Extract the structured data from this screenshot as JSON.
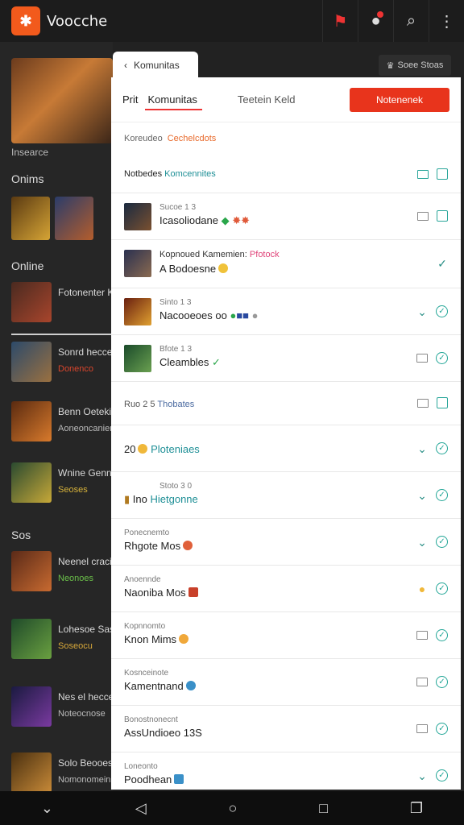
{
  "app": {
    "title": "Voocche"
  },
  "background": {
    "hero_label": "Insearce",
    "section1": "Onims",
    "section2": "Online",
    "section3": "Sos",
    "rows": [
      {
        "title": "Fotonenter Ker",
        "sub": ""
      },
      {
        "title": "Sonrd hecce",
        "sub": "Donenco"
      },
      {
        "title": "Benn Oetekit",
        "sub": "Aoneoncaniene"
      },
      {
        "title": "Wnine Genno",
        "sub": "Seoses"
      },
      {
        "title": "Neenel cracie",
        "sub": "Neonoes"
      },
      {
        "title": "Lohesoe Sas",
        "sub": "Soseocu"
      },
      {
        "title": "Nes el hecces",
        "sub": "Noteocnose"
      },
      {
        "title": "Solo Beooes",
        "sub": "Nomonomeins"
      }
    ],
    "right_badge": "Soee Stoas"
  },
  "panel": {
    "chip": "Komunitas",
    "tabs": {
      "first": "Prit",
      "active": "Komunitas",
      "other": "Teetein Keld"
    },
    "cta": "Notenenek",
    "breadcrumb": {
      "a": "Koreudeo",
      "b": "Cechelcdots"
    },
    "rows": [
      {
        "l1": "Notbedes",
        "l2": "Komcennites",
        "l2b": "",
        "style": "header"
      },
      {
        "l1": "Sucoe 1 3",
        "l2": "Icasoliodane",
        "l2b": ""
      },
      {
        "l1": "Kopnoued Kamemien:",
        "l1b": "Pfotock",
        "l2": "A Bodoesne",
        "l2b": ""
      },
      {
        "l1": "Sinto 1 3",
        "l2": "Nacooeoes oo",
        "l2b": ""
      },
      {
        "l1": "Bfote 1 3",
        "l2": "Cleambles",
        "l2b": ""
      },
      {
        "l1": "Ruo 2 5",
        "l2": "Thobates",
        "l2b": "",
        "style": "sub"
      },
      {
        "l1": "",
        "l2": "20",
        "l2b": "Ploteniaes"
      },
      {
        "l1": "Stoto 3 0",
        "l2": "Ino",
        "l2b": "Hietgonne"
      },
      {
        "l1": "Ponecnemto",
        "l2": "Rhgote Mos",
        "l2b": ""
      },
      {
        "l1": "Anoennde",
        "l2": "Naoniba Mos",
        "l2b": ""
      },
      {
        "l1": "Kopnnomto",
        "l2": "Knon Mims",
        "l2b": ""
      },
      {
        "l1": "Kosnceinote",
        "l2": "Kamentnand",
        "l2b": ""
      },
      {
        "l1": "Bonostnonecnt",
        "l2": "AssUndioeo 13S",
        "l2b": ""
      },
      {
        "l1": "Loneonto",
        "l2": "Poodhean",
        "l2b": ""
      }
    ]
  }
}
